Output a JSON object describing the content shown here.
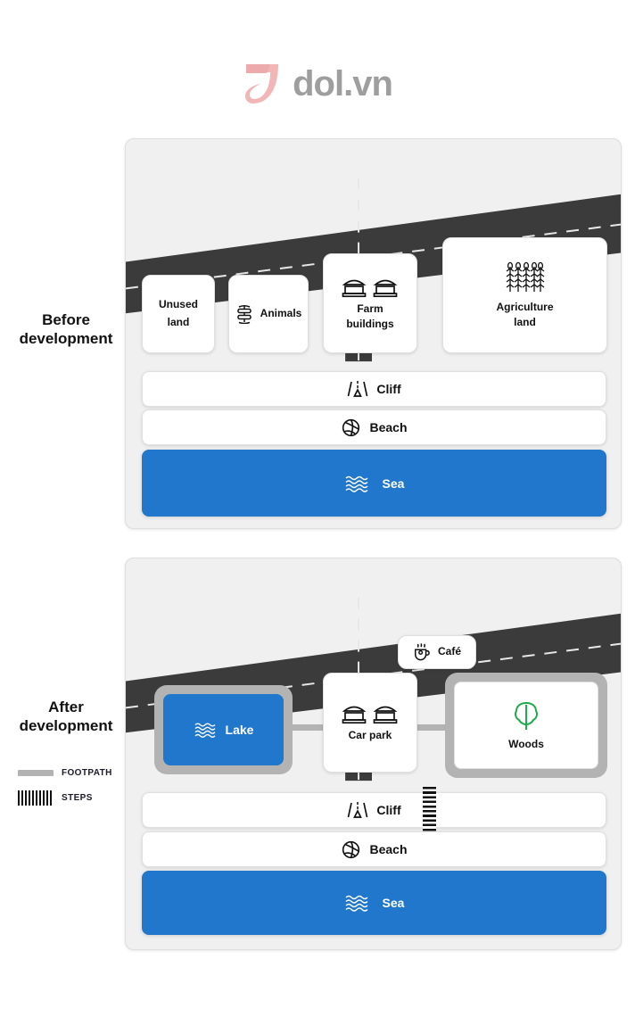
{
  "brand": {
    "name": "dol.vn",
    "logo_icon": "dol-leaf-logo-icon",
    "text_color": "#9e9e9e",
    "mark_color": "#f0b3b3"
  },
  "colors": {
    "water": "#2177cb",
    "road": "#3b3b3b",
    "footpath": "#b3b3b3",
    "panel_bg": "#f0f0f0",
    "card_bg": "#ffffff",
    "woods_green": "#1faa4b"
  },
  "sections": [
    {
      "id": "before",
      "label": "Before\ndevelopment",
      "label_line1": "Before",
      "label_line2": "development",
      "features": [
        {
          "name": "Unused land",
          "line1": "Unused",
          "line2": "land",
          "icon": null,
          "kind": "card"
        },
        {
          "name": "Animals",
          "line1": "Animals",
          "icon": "animals-icon",
          "kind": "card"
        },
        {
          "name": "Farm buildings",
          "line1": "Farm",
          "line2": "buildings",
          "icon": "farm-buildings-icon",
          "kind": "card"
        },
        {
          "name": "Agriculture land",
          "line1": "Agriculture",
          "line2": "land",
          "icon": "wheat-icon",
          "kind": "card"
        },
        {
          "name": "Cliff",
          "icon": "cliff-icon",
          "kind": "band"
        },
        {
          "name": "Beach",
          "icon": "beach-ball-icon",
          "kind": "band"
        },
        {
          "name": "Sea",
          "icon": "waves-icon",
          "kind": "band-water"
        }
      ]
    },
    {
      "id": "after",
      "label": "After\ndevelopment",
      "label_line1": "After",
      "label_line2": "development",
      "features": [
        {
          "name": "Café",
          "line1": "Café",
          "icon": "coffee-cup-icon",
          "kind": "card"
        },
        {
          "name": "Lake",
          "line1": "Lake",
          "icon": "waves-icon",
          "kind": "path-water"
        },
        {
          "name": "Car park",
          "line1": "Car park",
          "icon": "farm-buildings-icon",
          "kind": "card"
        },
        {
          "name": "Woods",
          "line1": "Woods",
          "icon": "tree-icon",
          "kind": "path-card"
        },
        {
          "name": "Cliff",
          "icon": "cliff-icon",
          "kind": "band"
        },
        {
          "name": "Beach",
          "icon": "beach-ball-icon",
          "kind": "band"
        },
        {
          "name": "Sea",
          "icon": "waves-icon",
          "kind": "band-water"
        }
      ]
    }
  ],
  "legend": [
    {
      "key": "footpath-swatch",
      "label": "FOOTPATH"
    },
    {
      "key": "steps-swatch",
      "label": "STEPS"
    }
  ]
}
